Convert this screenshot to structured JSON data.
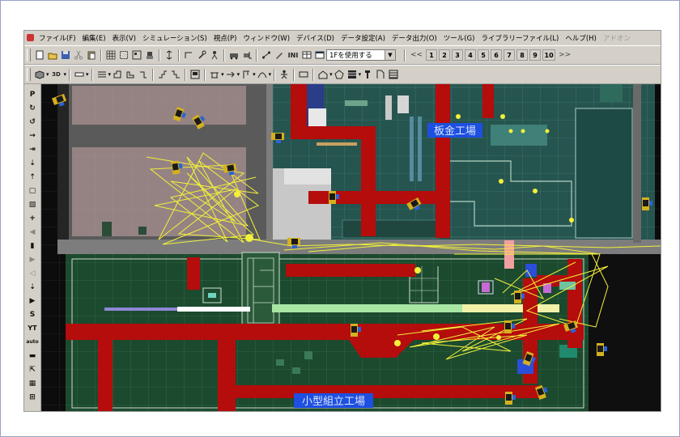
{
  "menu": {
    "items": [
      "ファイル(F)",
      "編集(E)",
      "表示(V)",
      "シミュレーション(S)",
      "視点(P)",
      "ウィンドウ(W)",
      "デバイス(D)",
      "データ設定(A)",
      "データ出力(O)",
      "ツール(G)",
      "ライブラリーファイル(L)",
      "ヘルプ(H)",
      "アドオン"
    ]
  },
  "toolbar": {
    "ini_label": "INI",
    "floor_select": "1Fを使用する",
    "pages": [
      "1",
      "2",
      "3",
      "4",
      "5",
      "6",
      "7",
      "8",
      "9",
      "10"
    ],
    "prev_label": "<<",
    "next_label": ">>",
    "mode_3d": "3D"
  },
  "left_tools": [
    "P",
    "↻",
    "↺",
    "→",
    "⇥",
    "⇣",
    "⇡",
    "▢",
    "▧",
    "+",
    "◀",
    "▮",
    "▶",
    "◁",
    "⇣",
    "▶",
    "S",
    "YT",
    "auto",
    "▬",
    "⇱",
    "▦",
    "⊞"
  ],
  "map": {
    "sheet_metal_label": "板金工場",
    "small_assembly_label": "小型組立工場"
  },
  "colors": {
    "floor_green": "#1c4a2e",
    "floor_teal": "#265550",
    "conveyor_red": "#b50c0c",
    "path_yellow": "#f2f03a",
    "aisle_gray": "#7d7d7d",
    "label_bg": "#1d4fe0"
  }
}
